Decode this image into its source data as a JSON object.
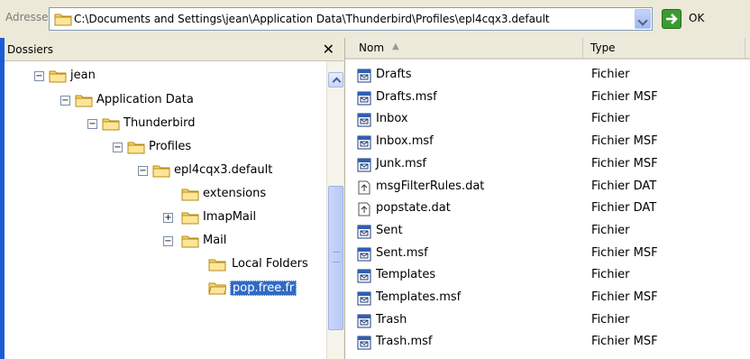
{
  "address": {
    "label": "Adresse",
    "path": "C:\\Documents and Settings\\jean\\Application Data\\Thunderbird\\Profiles\\epl4cqx3.default",
    "go_label": "OK"
  },
  "folders": {
    "title": "Dossiers",
    "close_glyph": "✕",
    "items": [
      {
        "label": "jean",
        "toggle": "−"
      },
      {
        "label": "Application Data",
        "toggle": "−"
      },
      {
        "label": "Thunderbird",
        "toggle": "−"
      },
      {
        "label": "Profiles",
        "toggle": "−"
      },
      {
        "label": "epl4cqx3.default",
        "toggle": "−"
      },
      {
        "label": "extensions",
        "toggle": ""
      },
      {
        "label": "ImapMail",
        "toggle": "+"
      },
      {
        "label": "Mail",
        "toggle": "−"
      },
      {
        "label": "Local Folders",
        "toggle": ""
      },
      {
        "label": "pop.free.fr",
        "toggle": "",
        "selected": true
      }
    ]
  },
  "files": {
    "columns": {
      "name": "Nom",
      "type": "Type"
    },
    "sort_indicator": "▲",
    "rows": [
      {
        "name": "Drafts",
        "type": "Fichier",
        "icon": "mail-file-icon"
      },
      {
        "name": "Drafts.msf",
        "type": "Fichier MSF",
        "icon": "mail-file-icon"
      },
      {
        "name": "Inbox",
        "type": "Fichier",
        "icon": "mail-file-icon"
      },
      {
        "name": "Inbox.msf",
        "type": "Fichier MSF",
        "icon": "mail-file-icon"
      },
      {
        "name": "Junk.msf",
        "type": "Fichier MSF",
        "icon": "mail-file-icon"
      },
      {
        "name": "msgFilterRules.dat",
        "type": "Fichier DAT",
        "icon": "data-file-icon"
      },
      {
        "name": "popstate.dat",
        "type": "Fichier DAT",
        "icon": "data-file-icon"
      },
      {
        "name": "Sent",
        "type": "Fichier",
        "icon": "mail-file-icon"
      },
      {
        "name": "Sent.msf",
        "type": "Fichier MSF",
        "icon": "mail-file-icon"
      },
      {
        "name": "Templates",
        "type": "Fichier",
        "icon": "mail-file-icon"
      },
      {
        "name": "Templates.msf",
        "type": "Fichier MSF",
        "icon": "mail-file-icon"
      },
      {
        "name": "Trash",
        "type": "Fichier",
        "icon": "mail-file-icon"
      },
      {
        "name": "Trash.msf",
        "type": "Fichier MSF",
        "icon": "mail-file-icon"
      }
    ]
  },
  "colors": {
    "folder_yellow": "#f4d76a",
    "selection_blue": "#316ac5",
    "go_green": "#3b9b2f",
    "pane_accent": "#1d5bd6"
  }
}
